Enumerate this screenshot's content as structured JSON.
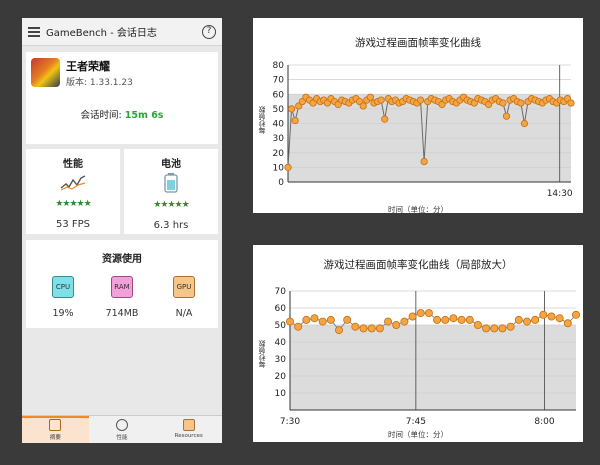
{
  "app": {
    "title": "GameBench - 会话日志",
    "help_symbol": "?"
  },
  "game": {
    "name": "王者荣耀",
    "version": "版本: 1.33.1.23",
    "session_label": "会话时间: ",
    "session_value": "15m 6s"
  },
  "stats": {
    "performance": {
      "label": "性能",
      "stars": "★★★★★",
      "value": "53 FPS"
    },
    "battery": {
      "label": "电池",
      "stars": "★★★★★",
      "value": "6.3 hrs"
    }
  },
  "resources": {
    "title": "资源使用",
    "items": [
      {
        "chip": "CPU",
        "value": "19%"
      },
      {
        "chip": "RAM",
        "value": "714MB"
      },
      {
        "chip": "GPU",
        "value": "N/A"
      }
    ]
  },
  "bottom_tabs": [
    {
      "label": "摘要",
      "active": true
    },
    {
      "label": "性能",
      "active": false
    },
    {
      "label": "Resources",
      "active": false
    }
  ],
  "chart_data": [
    {
      "type": "line",
      "title": "游戏过程画面帧率变化曲线",
      "xlabel": "时间（单位：分）",
      "ylabel": "每秒帧数",
      "ylim": [
        0,
        80
      ],
      "yticks": [
        0,
        10,
        20,
        30,
        40,
        50,
        60,
        70,
        80
      ],
      "xticks": [
        "14:30"
      ],
      "x": [
        0,
        1,
        2,
        3,
        4,
        5,
        6,
        7,
        8,
        9,
        10,
        11,
        12,
        13,
        14,
        15,
        16,
        17,
        18,
        19,
        20,
        21,
        22,
        23,
        24,
        25,
        26,
        27,
        28,
        29,
        30,
        31,
        32,
        33,
        34,
        35,
        36,
        37,
        38,
        39,
        40,
        41,
        42,
        43,
        44,
        45,
        46,
        47,
        48,
        49,
        50,
        51,
        52,
        53,
        54,
        55,
        56,
        57,
        58,
        59,
        60,
        61,
        62,
        63,
        64,
        65,
        66,
        67,
        68,
        69,
        70,
        71,
        72,
        73,
        74,
        75,
        76,
        77,
        78,
        79
      ],
      "series": [
        {
          "values": [
            10,
            50,
            42,
            52,
            55,
            58,
            56,
            54,
            57,
            55,
            56,
            54,
            57,
            55,
            53,
            56,
            55,
            54,
            56,
            57,
            55,
            52,
            56,
            58,
            54,
            55,
            56,
            43,
            57,
            55,
            56,
            54,
            55,
            57,
            56,
            55,
            54,
            56,
            14,
            55,
            57,
            56,
            55,
            53,
            56,
            57,
            55,
            54,
            56,
            58,
            56,
            55,
            54,
            57,
            56,
            55,
            53,
            56,
            57,
            55,
            54,
            45,
            56,
            57,
            55,
            54,
            40,
            55,
            57,
            56,
            55,
            54,
            56,
            57,
            55,
            54,
            56,
            55,
            57,
            54
          ]
        }
      ]
    },
    {
      "type": "line",
      "title": "游戏过程画面帧率变化曲线（局部放大）",
      "xlabel": "时间（单位：分）",
      "ylabel": "每秒帧数",
      "ylim": [
        0,
        70
      ],
      "yticks": [
        10,
        20,
        30,
        40,
        50,
        60,
        70
      ],
      "xticks": [
        "7:30",
        "7:45",
        "8:00"
      ],
      "x": [
        0,
        1,
        2,
        3,
        4,
        5,
        6,
        7,
        8,
        9,
        10,
        11,
        12,
        13,
        14,
        15,
        16,
        17,
        18,
        19,
        20,
        21,
        22,
        23,
        24,
        25,
        26,
        27,
        28,
        29,
        30,
        31,
        32,
        33,
        34,
        35
      ],
      "series": [
        {
          "values": [
            52,
            49,
            53,
            54,
            52,
            53,
            47,
            53,
            49,
            48,
            48,
            48,
            52,
            50,
            52,
            55,
            57,
            57,
            53,
            53,
            54,
            53,
            53,
            50,
            48,
            48,
            48,
            49,
            53,
            52,
            53,
            56,
            55,
            54,
            51,
            56
          ]
        }
      ]
    }
  ]
}
